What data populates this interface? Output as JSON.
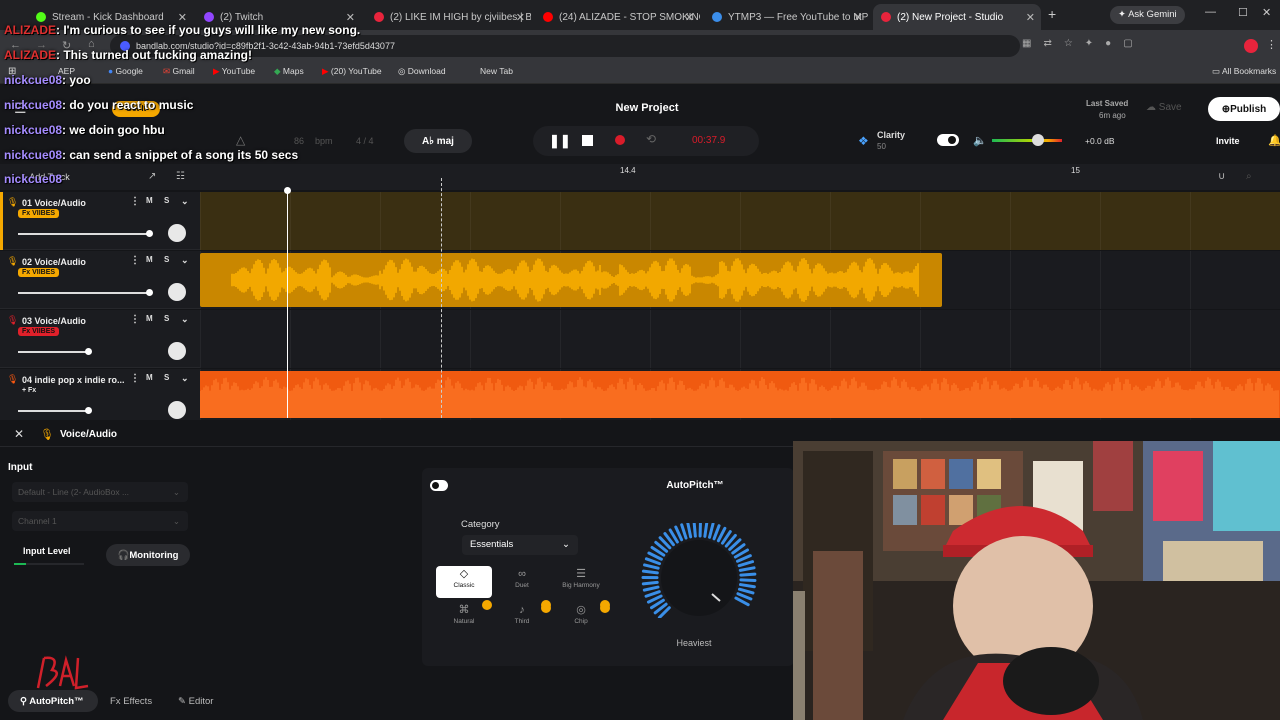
{
  "browser": {
    "tabs": [
      {
        "label": "Stream - Kick Dashboard",
        "color": "#53fc18"
      },
      {
        "label": "(2) Twitch",
        "color": "#9146ff"
      },
      {
        "label": "(2) LIKE IM HIGH by cjviibes | B",
        "color": "#e8243c"
      },
      {
        "label": "(24) ALIZADE - STOP SMOKING",
        "color": "#ff0000"
      },
      {
        "label": "YTMP3 — Free YouTube to MP",
        "color": "#3b8eea"
      },
      {
        "label": "(2) New Project - Studio",
        "color": "#e8243c"
      }
    ],
    "ask_gemini": "Ask Gemini",
    "url": "bandlab.com/studio?id=c89fb2f1-3c42-43ab-94b1-73efd5d43077",
    "bookmarks": [
      "AEP",
      "Google",
      "Gmail",
      "YouTube",
      "Maps",
      "(20) YouTube",
      "Download",
      "New Tab"
    ],
    "all_bookmarks": "All Bookmarks"
  },
  "chat": [
    {
      "user": "ALIZADE",
      "text": ": I'm curious to see if you guys will like my new song."
    },
    {
      "user": "ALIZADE",
      "text": ": This turned out fucking amazing!"
    },
    {
      "user": "nickcue08",
      "text": ": yoo"
    },
    {
      "user": "nickcue08",
      "text": ": do you react to music"
    },
    {
      "user": "nickcue08",
      "text": ": we doin goo hbu"
    },
    {
      "user": "nickcue08",
      "text": ": can send a snippet of a song its 50 secs"
    },
    {
      "user": "nickcue08",
      "text": ""
    }
  ],
  "studio": {
    "project_title": "New Project",
    "last_saved_label": "Last Saved",
    "last_saved_value": "6m ago",
    "save_label": "Save",
    "publish_label": "Publish",
    "invite_label": "Invite",
    "get_label": "Get It",
    "bpm_value": "86",
    "bpm_label": "bpm",
    "time_sig": "4 / 4",
    "key": "A♭ maj",
    "time_display": "00:37.9",
    "clarity_label": "Clarity",
    "clarity_value": "50",
    "db_value": "+0.0 dB",
    "ruler_marks": [
      "14.4",
      "15"
    ],
    "add_track_label": "+ Add Track",
    "tracks": [
      {
        "name": "01 Voice/Audio",
        "fx": "Fx VIIBES",
        "fx_color": "#f5a800",
        "color": "#f5a800"
      },
      {
        "name": "02 Voice/Audio",
        "fx": "Fx VIIBES",
        "fx_color": "#f5a800",
        "color": "#f5a800"
      },
      {
        "name": "03 Voice/Audio",
        "fx": "Fx VIIBES",
        "fx_color": "#e0202a",
        "color": "#e0202a"
      },
      {
        "name": "04 indie pop x indie ro...",
        "fx": "+ Fx",
        "fx_color": "transparent",
        "color": "#ff5a10"
      }
    ],
    "m_label": "M",
    "s_label": "S"
  },
  "panel": {
    "title": "Voice/Audio",
    "input_label": "Input",
    "input_device": "Default - Line (2- AudioBox ...",
    "channel": "Channel 1",
    "input_level_label": "Input Level",
    "monitoring_label": "Monitoring",
    "effect_title": "AutoPitch™",
    "category_label": "Category",
    "category_value": "Essentials",
    "presets": [
      "Classic",
      "Duet",
      "Big Harmony",
      "Natural",
      "Third",
      "Chip"
    ],
    "knob_label": "Heaviest",
    "bottom_tabs": [
      "AutoPitch™",
      "Effects",
      "Editor"
    ]
  }
}
